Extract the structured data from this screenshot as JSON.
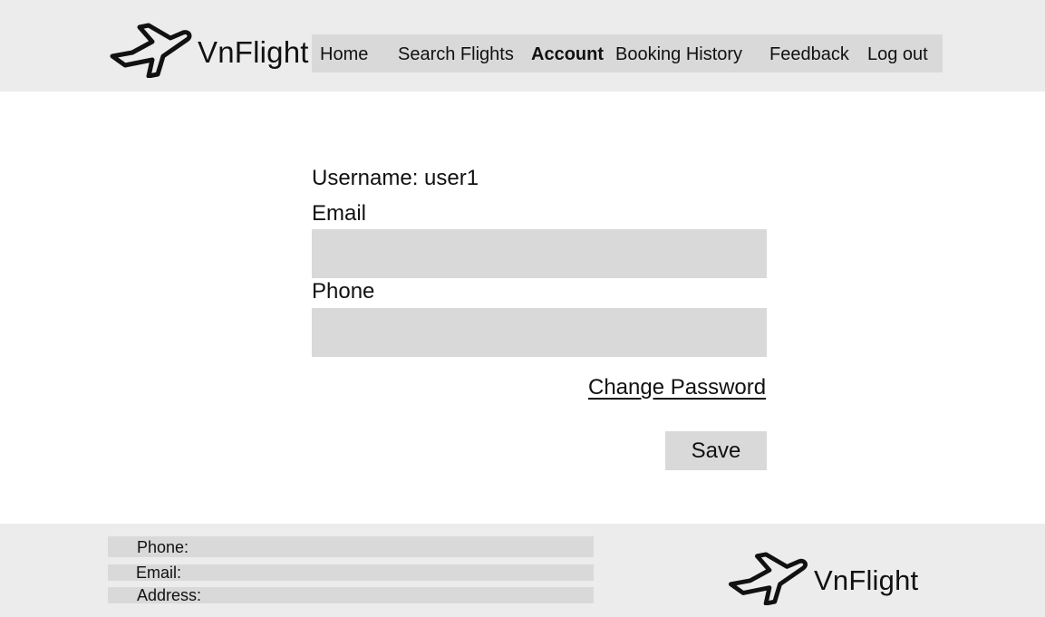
{
  "brand": {
    "name": "VnFlight",
    "icon": "airplane-icon"
  },
  "nav": {
    "items": [
      {
        "label": "Home",
        "active": false
      },
      {
        "label": "Search Flights",
        "active": false
      },
      {
        "label": "Account",
        "active": true
      },
      {
        "label": "Booking History",
        "active": false
      },
      {
        "label": "Feedback",
        "active": false
      },
      {
        "label": "Log out",
        "active": false
      }
    ]
  },
  "account": {
    "username_text": "Username: user1",
    "email_label": "Email",
    "email_value": "",
    "phone_label": "Phone",
    "phone_value": "",
    "change_password_label": "Change Password",
    "save_label": "Save"
  },
  "footer": {
    "phone_label": "Phone:",
    "email_label": "Email:",
    "address_label": "Address:"
  },
  "colors": {
    "bar_background": "#ececec",
    "field_background": "#d9d9d9",
    "text": "#111111"
  }
}
